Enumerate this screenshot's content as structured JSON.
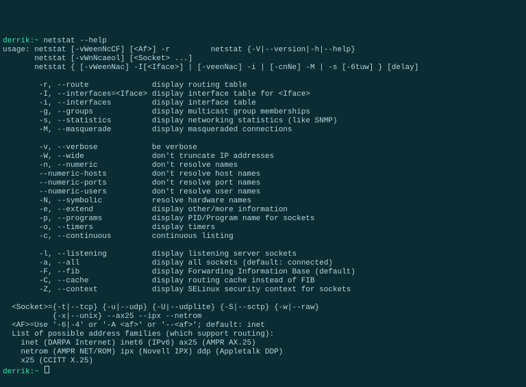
{
  "prompt_user": "derrik",
  "prompt_host": "~",
  "command": "netstat --help",
  "usage_lines": [
    "usage: netstat [-vWeenNcCF] [<Af>] -r         netstat {-V|--version|-h|--help}",
    "       netstat [-vWnNcaeol] [<Socket> ...]",
    "       netstat { [-vWeenNac] -I[<Iface>] | [-veenNac] -i | [-cnNe] -M | -s [-6tuw] } [delay]"
  ],
  "options_block1": [
    {
      "flag": "-r, --route",
      "desc": "display routing table"
    },
    {
      "flag": "-I, --interfaces=<Iface>",
      "desc": "display interface table for <Iface>"
    },
    {
      "flag": "-i, --interfaces",
      "desc": "display interface table"
    },
    {
      "flag": "-g, --groups",
      "desc": "display multicast group memberships"
    },
    {
      "flag": "-s, --statistics",
      "desc": "display networking statistics (like SNMP)"
    },
    {
      "flag": "-M, --masquerade",
      "desc": "display masqueraded connections"
    }
  ],
  "options_block2": [
    {
      "flag": "-v, --verbose",
      "desc": "be verbose"
    },
    {
      "flag": "-W, --wide",
      "desc": "don't truncate IP addresses"
    },
    {
      "flag": "-n, --numeric",
      "desc": "don't resolve names"
    },
    {
      "flag": "--numeric-hosts",
      "desc": "don't resolve host names"
    },
    {
      "flag": "--numeric-ports",
      "desc": "don't resolve port names"
    },
    {
      "flag": "--numeric-users",
      "desc": "don't resolve user names"
    },
    {
      "flag": "-N, --symbolic",
      "desc": "resolve hardware names"
    },
    {
      "flag": "-e, --extend",
      "desc": "display other/more information"
    },
    {
      "flag": "-p, --programs",
      "desc": "display PID/Program name for sockets"
    },
    {
      "flag": "-o, --timers",
      "desc": "display timers"
    },
    {
      "flag": "-c, --continuous",
      "desc": "continuous listing"
    }
  ],
  "options_block3": [
    {
      "flag": "-l, --listening",
      "desc": "display listening server sockets"
    },
    {
      "flag": "-a, --all",
      "desc": "display all sockets (default: connected)"
    },
    {
      "flag": "-F, --fib",
      "desc": "display Forwarding Information Base (default)"
    },
    {
      "flag": "-C, --cache",
      "desc": "display routing cache instead of FIB"
    },
    {
      "flag": "-Z, --context",
      "desc": "display SELinux security context for sockets"
    }
  ],
  "socket_lines": [
    "  <Socket>={-t|--tcp} {-u|--udp} {-U|--udplite} {-S|--sctp} {-w|--raw}",
    "           {-x|--unix} --ax25 --ipx --netrom"
  ],
  "af_lines": [
    "  <AF>=Use '-6|-4' or '-A <af>' or '--<af>'; default: inet",
    "  List of possible address families (which support routing):",
    "    inet (DARPA Internet) inet6 (IPv6) ax25 (AMPR AX.25)",
    "    netrom (AMPR NET/ROM) ipx (Novell IPX) ddp (Appletalk DDP)",
    "    x25 (CCITT X.25)"
  ]
}
